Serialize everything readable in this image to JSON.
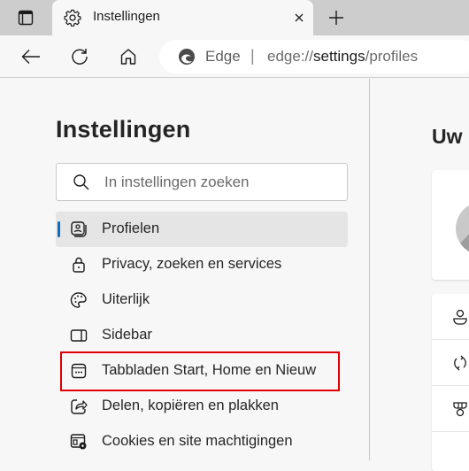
{
  "browser": {
    "tab": {
      "title": "Instellingen",
      "icon": "gear-icon"
    },
    "address_bar": {
      "site_label": "Edge",
      "separator": "|",
      "url_prefix": "edge://",
      "url_host": "settings",
      "url_path": "/profiles"
    }
  },
  "sidebar": {
    "title": "Instellingen",
    "search": {
      "placeholder": "In instellingen zoeken",
      "value": ""
    },
    "items": [
      {
        "label": "Profielen",
        "icon": "profile-icon",
        "active": true
      },
      {
        "label": "Privacy, zoeken en services",
        "icon": "lock-icon",
        "active": false
      },
      {
        "label": "Uiterlijk",
        "icon": "palette-icon",
        "active": false
      },
      {
        "label": "Sidebar",
        "icon": "sidebar-icon",
        "active": false
      },
      {
        "label": "Tabbladen Start, Home en Nieuw",
        "icon": "new-tab-page-icon",
        "active": false,
        "highlighted": true
      },
      {
        "label": "Delen, kopiëren en plakken",
        "icon": "share-icon",
        "active": false
      },
      {
        "label": "Cookies en site machtigingen",
        "icon": "cookies-site-permissions-icon",
        "active": false
      }
    ]
  },
  "main": {
    "title": "Uw",
    "rows": [
      {
        "icon": "person-icon"
      },
      {
        "icon": "sync-icon"
      },
      {
        "icon": "rewards-icon"
      }
    ]
  },
  "colors": {
    "accent": "#0f6cbd",
    "highlight_border": "#e00000"
  }
}
